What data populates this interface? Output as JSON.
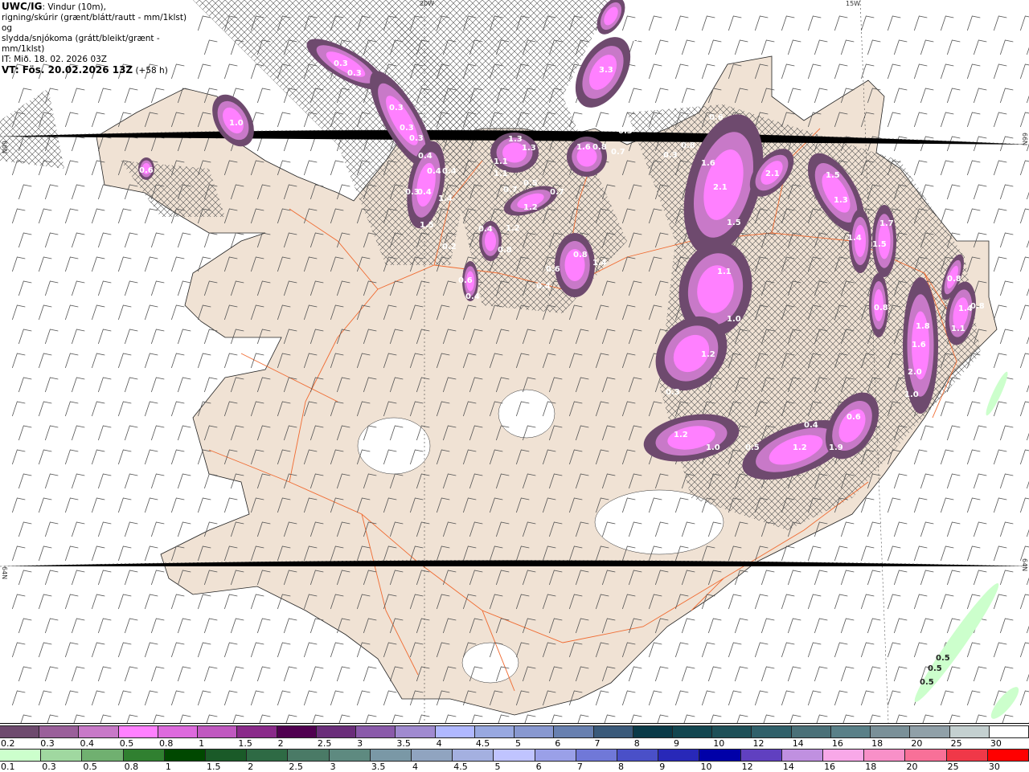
{
  "header": {
    "model": "UWC/IG",
    "line1": ": Vindur (10m),",
    "line2": "rigning/skúrir (grænt/blátt/rautt - mm/1klst) og",
    "line3": "slydda/snjókoma (grátt/bleikt/grænt - mm/1klst)",
    "it": "IT: Mið. 18. 02. 2026 03Z",
    "vt": "VT: Fös. 20.02.2026 13Z",
    "lead": " (+58 h)"
  },
  "grid_labels": {
    "lon_20w": "20W",
    "lon_15w": "15W",
    "lat_66n_left": "66N",
    "lat_66n_right": "66N",
    "lat_64n_left": "64N",
    "lat_64n_right": "64N"
  },
  "precip_labels": [
    "0.3",
    "0.3",
    "0.3",
    "0.3",
    "0.3",
    "0.4",
    "0.4",
    "0.4",
    "0.3",
    "0.4",
    "1.4",
    "1.5",
    "0.2",
    "0.6",
    "0.4",
    "1.0",
    "0.6",
    "3.3",
    "0.7",
    "1.3",
    "1.3",
    "1.1",
    "1.1",
    "0.5",
    "0.7",
    "0.7",
    "1.2",
    "1.6",
    "0.8",
    "0.7",
    "0.3",
    "0.8",
    "0.4",
    "1.2",
    "0.6",
    "0.4",
    "0.8",
    "1.4",
    "0.6",
    "0.8",
    "0.3",
    "1.6",
    "2.1",
    "2.1",
    "1.5",
    "1.3",
    "1.5",
    "1.4",
    "1.7",
    "1.5",
    "1.1",
    "1.0",
    "1.2",
    "0.3",
    "0.8",
    "1.8",
    "1.6",
    "2.0",
    "1.0",
    "0.8",
    "1.4",
    "0.8",
    "1.1",
    "0.4",
    "0.6",
    "1.2",
    "1.0",
    "0.5",
    "1.2",
    "1.9",
    "0.5",
    "0.5",
    "0.5"
  ],
  "legend": {
    "snow": {
      "labels": [
        "0.2",
        "0.3",
        "0.4",
        "0.5",
        "0.8",
        "1",
        "1.5",
        "2",
        "2.5",
        "3",
        "3.5",
        "4",
        "4.5",
        "5",
        "6",
        "7",
        "8",
        "9",
        "10",
        "12",
        "14",
        "16",
        "18",
        "20",
        "25",
        "30"
      ],
      "colors": [
        "#6e4a6e",
        "#9a5f9a",
        "#c879c8",
        "#ff80ff",
        "#dd6add",
        "#c058c0",
        "#8a2a8a",
        "#500050",
        "#6a2d7a",
        "#8a5aaa",
        "#a08ad0",
        "#b0b8ff",
        "#98a8e0",
        "#8898d0",
        "#6880b0",
        "#3a5a7a",
        "#0a3a48",
        "#124650",
        "#1e5058",
        "#30606a",
        "#4a7078",
        "#5a8088",
        "#7a9098",
        "#90a0a8",
        "#c4d0d0",
        "#ffffff"
      ]
    },
    "rain": {
      "labels": [
        "0.1",
        "0.3",
        "0.5",
        "0.8",
        "1",
        "1.5",
        "2",
        "2.5",
        "3",
        "3.5",
        "4",
        "4.5",
        "5",
        "6",
        "7",
        "8",
        "9",
        "10",
        "12",
        "14",
        "16",
        "18",
        "20",
        "25",
        "30"
      ],
      "colors": [
        "#ccffcc",
        "#a0d8a0",
        "#70b070",
        "#308030",
        "#004800",
        "#1a5a28",
        "#2e6a44",
        "#4a7a66",
        "#5e8a80",
        "#7a98a6",
        "#90a4c0",
        "#a4b0e0",
        "#c0c4ff",
        "#9aa0e8",
        "#7078d8",
        "#4a50c8",
        "#2828b8",
        "#0000a8",
        "#6040c0",
        "#c090e0",
        "#f8a8e8",
        "#f890c8",
        "#f87098",
        "#f03848",
        "#ff0000"
      ]
    }
  },
  "colors": {
    "land": "#f0e2d4",
    "road": "#f06a30",
    "glacier": "#ffffff",
    "sea": "#ffffff"
  }
}
